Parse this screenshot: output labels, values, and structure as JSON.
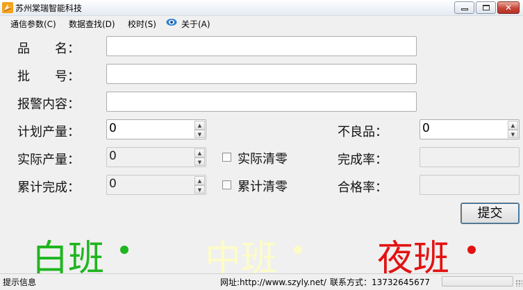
{
  "window": {
    "title": "苏州棠瑞智能科技",
    "close_glyph": "✕"
  },
  "menu": {
    "items": [
      "通信参数(C)",
      "数据查找(D)",
      "校时(S)",
      "关于(A)"
    ]
  },
  "form": {
    "product_name": {
      "label": "品　　名：",
      "value": ""
    },
    "batch_no": {
      "label": "批　　号：",
      "value": ""
    },
    "alarm_content": {
      "label": "报警内容：",
      "value": ""
    },
    "planned_output": {
      "label": "计划产量：",
      "value": "0"
    },
    "actual_output": {
      "label": "实际产量：",
      "value": "0"
    },
    "cumulative_done": {
      "label": "累计完成：",
      "value": "0"
    },
    "defective": {
      "label": "不良品：",
      "value": "0"
    },
    "completion_rate": {
      "label": "完成率：",
      "value": ""
    },
    "pass_rate": {
      "label": "合格率：",
      "value": ""
    },
    "clear_actual": {
      "label": "实际清零",
      "checked": false
    },
    "clear_cumulative": {
      "label": "累计清零",
      "checked": false
    },
    "submit_label": "提交"
  },
  "shifts": [
    {
      "label": "白班",
      "color": "#1fb51f",
      "dot_color": "#1fb51f"
    },
    {
      "label": "中班",
      "color": "#fdfcc8",
      "dot_color": "#fdfcc8"
    },
    {
      "label": "夜班",
      "color": "#e31212",
      "dot_color": "#e31212"
    }
  ],
  "status": {
    "hint": "提示信息",
    "website": "网址:http://www.szyly.net/",
    "contact": "联系方式：13732645677"
  },
  "colors": {
    "background": "#f0f0f0",
    "close_button": "#c8463a"
  }
}
